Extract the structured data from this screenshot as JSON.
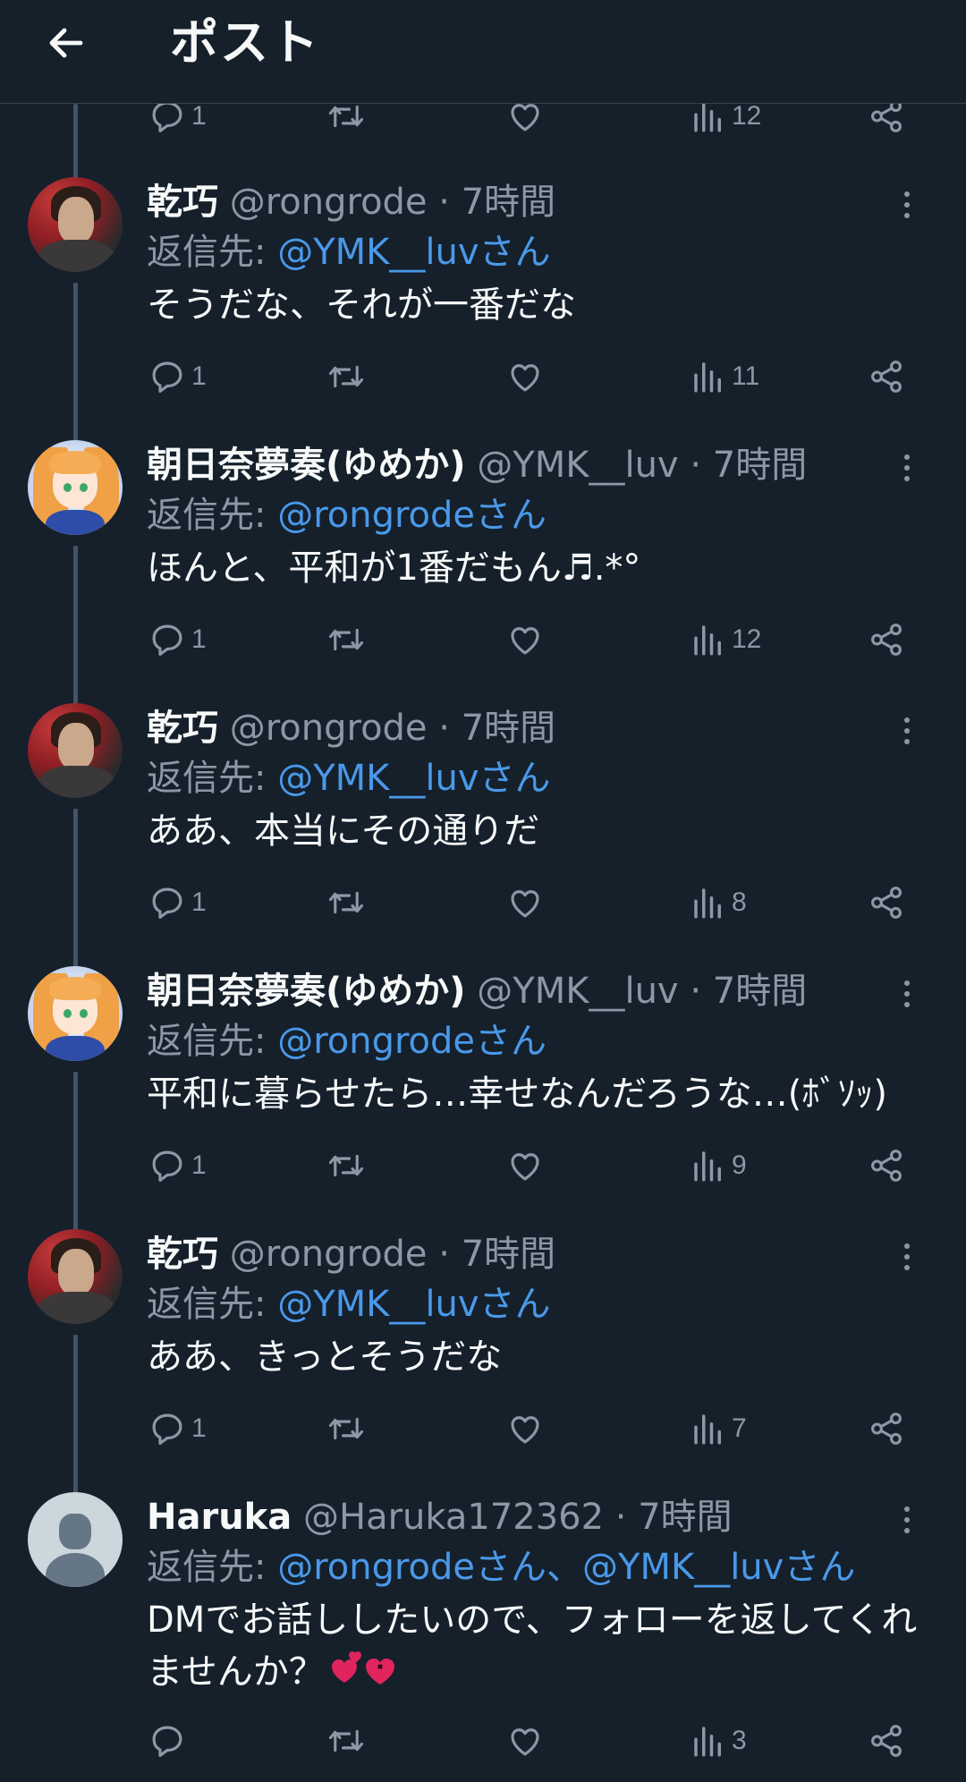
{
  "header": {
    "title": "ポスト"
  },
  "previous_actions": {
    "replies": "1",
    "views": "12"
  },
  "tweets": [
    {
      "name": "乾巧",
      "handle": "@rongrode",
      "time": "7時間",
      "avatar": "man-avatar",
      "reply_label": "返信先:",
      "mentions": "@YMK__luvさん",
      "text": "そうだな、それが一番だな",
      "replies": "1",
      "views": "11"
    },
    {
      "name": "朝日奈夢奏(ゆめか)",
      "handle": "@YMK__luv",
      "time": "7時間",
      "avatar": "anime-girl-avatar",
      "reply_label": "返信先:",
      "mentions": "@rongrodeさん",
      "text": "ほんと、平和が1番だもん♬.*°",
      "replies": "1",
      "views": "12"
    },
    {
      "name": "乾巧",
      "handle": "@rongrode",
      "time": "7時間",
      "avatar": "man-avatar",
      "reply_label": "返信先:",
      "mentions": "@YMK__luvさん",
      "text": "ああ、本当にその通りだ",
      "replies": "1",
      "views": "8"
    },
    {
      "name": "朝日奈夢奏(ゆめか)",
      "handle": "@YMK__luv",
      "time": "7時間",
      "avatar": "anime-girl-avatar",
      "reply_label": "返信先:",
      "mentions": "@rongrodeさん",
      "text": "平和に暮らせたら…幸せなんだろうな…(ﾎﾞｿｯ)",
      "replies": "1",
      "views": "9"
    },
    {
      "name": "乾巧",
      "handle": "@rongrode",
      "time": "7時間",
      "avatar": "man-avatar",
      "reply_label": "返信先:",
      "mentions": "@YMK__luvさん",
      "text": "ああ、きっとそうだな",
      "replies": "1",
      "views": "7"
    },
    {
      "name": "Haruka",
      "handle": "@Haruka172362",
      "time": "7時間",
      "avatar": "default-avatar",
      "reply_label": "返信先:",
      "mentions": "@rongrodeさん、@YMK__luvさん",
      "text": "DMでお話ししたいので、フォローを返してくれませんか？",
      "replies": "",
      "views": "3"
    }
  ],
  "separator": "·",
  "icons": [
    "back-arrow-icon",
    "reply-icon",
    "retweet-icon",
    "like-icon",
    "views-icon",
    "share-icon",
    "more-icon",
    "hearts-emoji-icon"
  ],
  "colors": {
    "background": "#15202b",
    "mention": "#4a99e9",
    "muted": "#8b98a5"
  }
}
